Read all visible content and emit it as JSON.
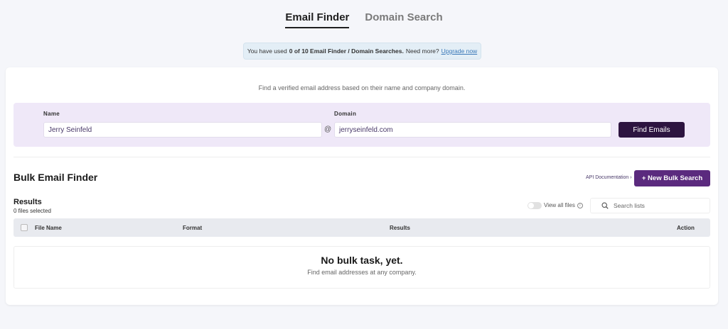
{
  "tabs": [
    {
      "label": "Email Finder",
      "active": true
    },
    {
      "label": "Domain Search",
      "active": false
    }
  ],
  "notice": {
    "prefix": "You have used",
    "usage": "0 of 10 Email Finder / Domain Searches.",
    "question": "Need more?",
    "link": "Upgrade now"
  },
  "finder": {
    "subtitle": "Find a verified email address based on their name and company domain.",
    "name_label": "Name",
    "name_value": "Jerry Seinfeld",
    "at_symbol": "@",
    "domain_label": "Domain",
    "domain_value": "jerryseinfeld.com",
    "button": "Find Emails"
  },
  "bulk": {
    "title": "Bulk Email Finder",
    "api_link": "API Documentation ›",
    "new_button": "+ New Bulk Search"
  },
  "results": {
    "title": "Results",
    "files_selected": "0 files selected",
    "view_all_label": "View all files",
    "search_placeholder": "Search lists",
    "columns": {
      "file_name": "File Name",
      "format": "Format",
      "results": "Results",
      "action": "Action"
    },
    "empty_title": "No bulk task, yet.",
    "empty_subtitle": "Find email addresses at any company."
  },
  "colors": {
    "primary_dark": "#2d1440",
    "primary": "#5b2a7e",
    "finder_bg": "#efe8f8",
    "notice_bg": "#e3eef6"
  }
}
